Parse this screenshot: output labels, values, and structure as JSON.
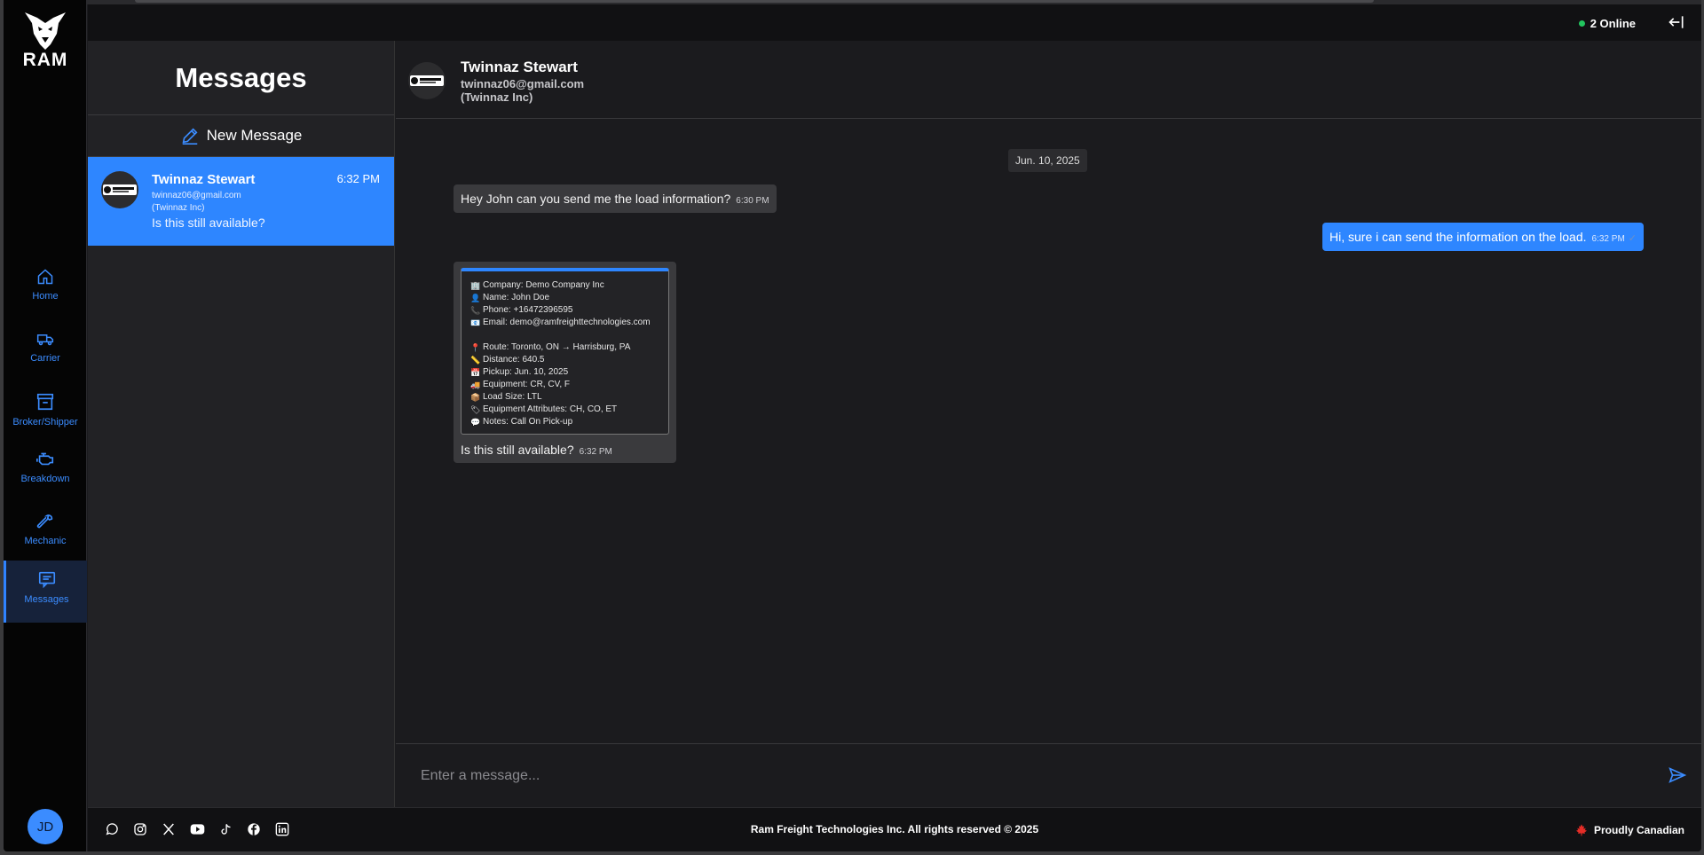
{
  "brand": {
    "name": "RAM"
  },
  "nav": {
    "items": [
      {
        "label": "Home",
        "icon": "home-icon"
      },
      {
        "label": "Carrier",
        "icon": "truck-icon"
      },
      {
        "label": "Broker/Shipper",
        "icon": "store-icon"
      },
      {
        "label": "Breakdown",
        "icon": "engine-icon"
      },
      {
        "label": "Mechanic",
        "icon": "wrench-icon"
      },
      {
        "label": "Messages",
        "icon": "message-icon"
      }
    ],
    "user_initials": "JD"
  },
  "topbar": {
    "online_text": "2 Online"
  },
  "conversations": {
    "title": "Messages",
    "new_message_label": "New Message",
    "items": [
      {
        "name": "Twinnaz Stewart",
        "time": "6:32 PM",
        "email": "twinnaz06@gmail.com",
        "company": "(Twinnaz Inc)",
        "preview": "Is this still available?"
      }
    ]
  },
  "chat": {
    "contact": {
      "name": "Twinnaz Stewart",
      "email": "twinnaz06@gmail.com",
      "company": "(Twinnaz Inc)"
    },
    "date_label": "Jun. 10, 2025",
    "messages": [
      {
        "text": "Hey John can you send me the load information?",
        "time": "6:30 PM",
        "direction": "incoming"
      },
      {
        "text": "Hi, sure i can send the information on the load.",
        "time": "6:32 PM",
        "direction": "outgoing"
      },
      {
        "direction": "incoming",
        "time": "6:32 PM",
        "text": "Is this still available?",
        "card": {
          "company": "Company: Demo Company Inc",
          "name": "Name: John Doe",
          "phone": "Phone: +16472396595",
          "email": "Email: demo@ramfreighttechnologies.com",
          "route": "Route: Toronto, ON → Harrisburg, PA",
          "distance": "Distance: 640.5",
          "pickup": "Pickup: Jun. 10, 2025",
          "equipment": "Equipment: CR, CV, F",
          "load_size": "Load Size: LTL",
          "attributes": "Equipment Attributes: CH, CO, ET",
          "notes": "Notes: Call On Pick-up"
        }
      }
    ],
    "composer_placeholder": "Enter a message..."
  },
  "footer": {
    "copyright": "Ram Freight Technologies Inc. All rights reserved © 2025",
    "canadian": "Proudly Canadian",
    "socials": [
      "whatsapp-icon",
      "instagram-icon",
      "x-icon",
      "youtube-icon",
      "tiktok-icon",
      "facebook-icon",
      "linkedin-icon"
    ]
  },
  "colors": {
    "accent": "#2e86ff",
    "online": "#22c55e",
    "rail_bg": "#050505",
    "panel_bg": "#222225"
  }
}
